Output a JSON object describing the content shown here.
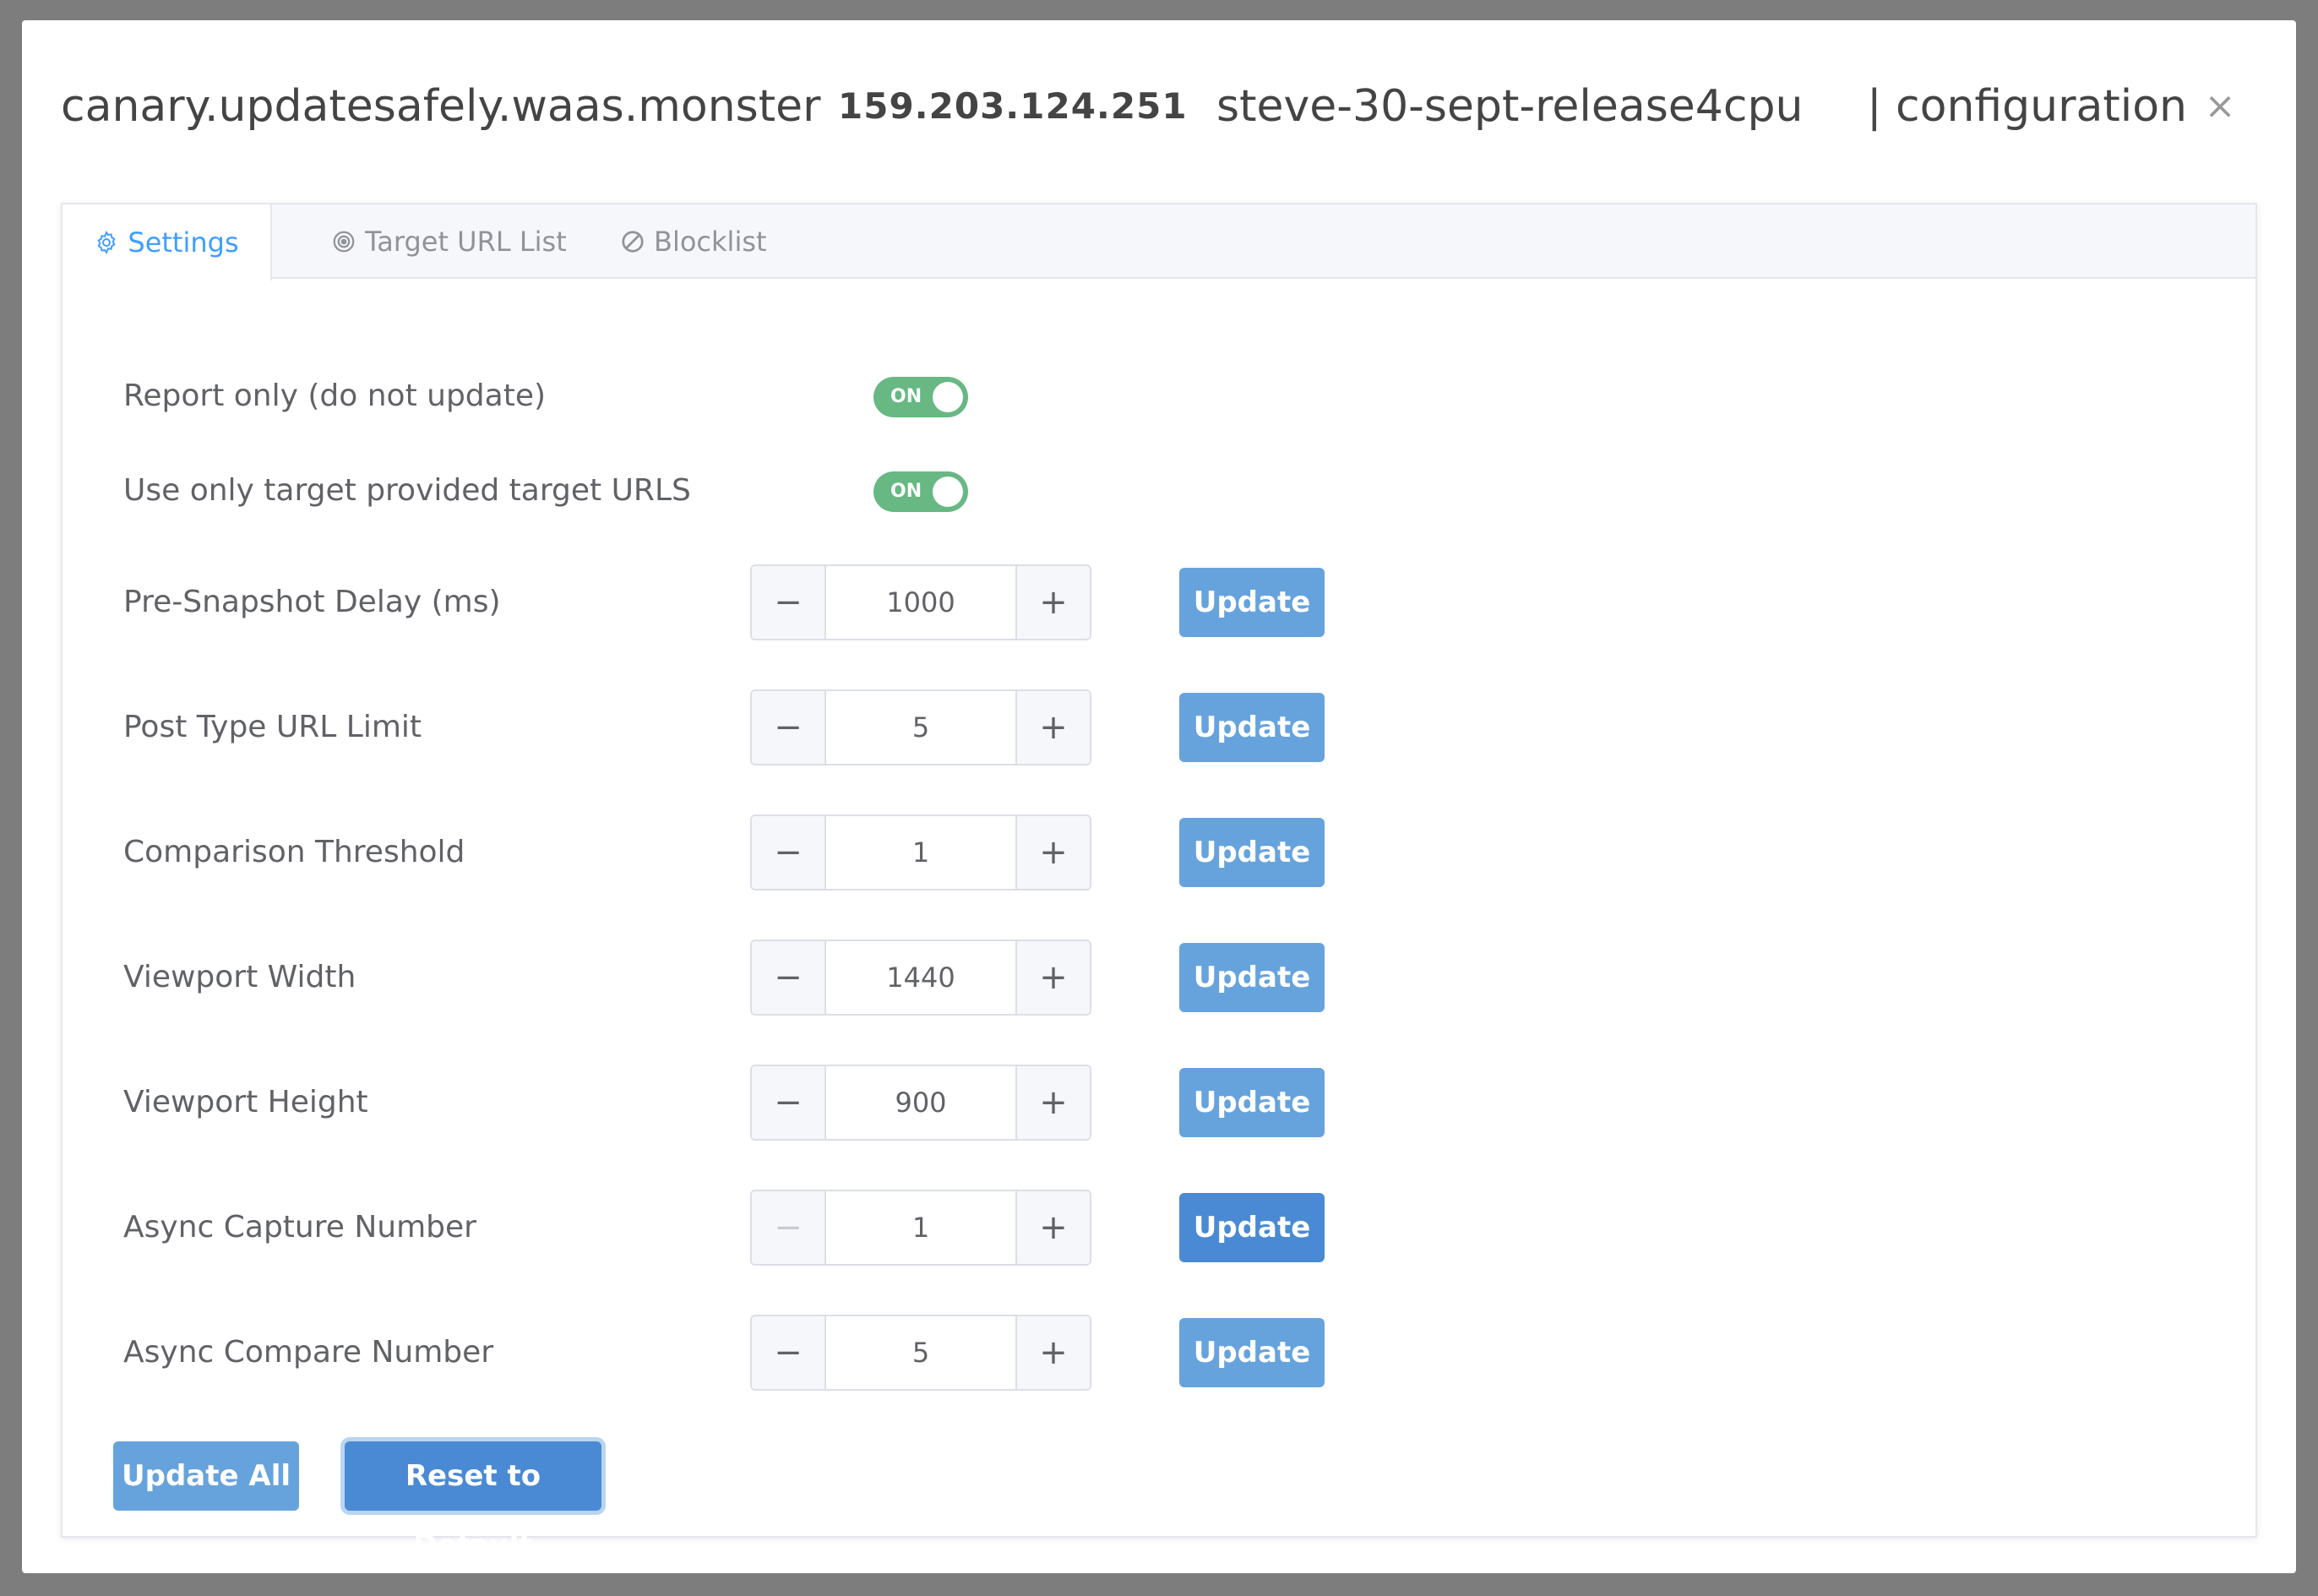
{
  "header": {
    "domain": "canary.updatesafely.waas.monster",
    "ip": "159.203.124.251",
    "instance": "steve-30-sept-release4cpu",
    "section": "| configuration",
    "close": "×"
  },
  "tabs": [
    {
      "label": "Settings",
      "icon": "gear-icon",
      "active": true
    },
    {
      "label": "Target URL List",
      "icon": "target-icon",
      "active": false
    },
    {
      "label": "Blocklist",
      "icon": "block-icon",
      "active": false
    }
  ],
  "toggles": [
    {
      "label": "Report only (do not update)",
      "state": "ON"
    },
    {
      "label": "Use only target provided target URLS",
      "state": "ON"
    }
  ],
  "settings": [
    {
      "label": "Pre-Snapshot Delay (ms)",
      "value": "1000",
      "button": "Update"
    },
    {
      "label": "Post Type URL Limit",
      "value": "5",
      "button": "Update"
    },
    {
      "label": "Comparison Threshold",
      "value": "1",
      "button": "Update"
    },
    {
      "label": "Viewport Width",
      "value": "1440",
      "button": "Update"
    },
    {
      "label": "Viewport Height",
      "value": "900",
      "button": "Update"
    },
    {
      "label": "Async Capture Number",
      "value": "1",
      "button": "Update"
    },
    {
      "label": "Async Compare Number",
      "value": "5",
      "button": "Update"
    }
  ],
  "stepper": {
    "minus": "−",
    "plus": "+"
  },
  "footer": {
    "update_all": "Update All",
    "reset": "Reset to Default"
  },
  "colors": {
    "accent": "#409eff",
    "toggle_on": "#67b883",
    "button": "#66a3dd",
    "button_active": "#4a8ad4"
  }
}
